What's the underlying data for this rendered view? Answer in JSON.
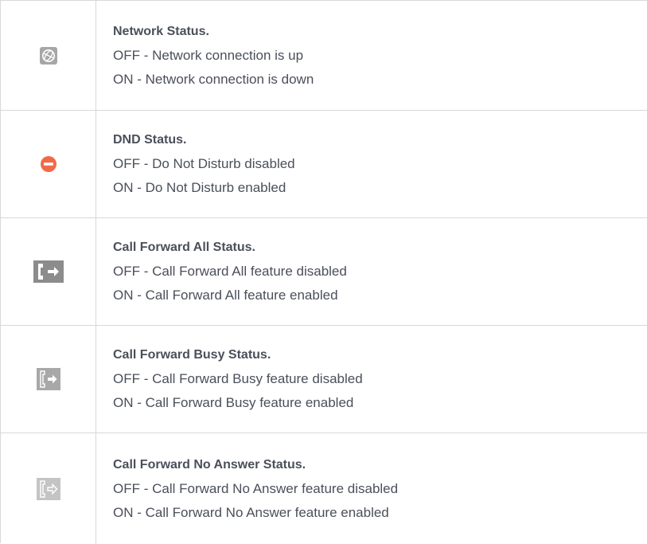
{
  "rows": [
    {
      "icon": "network-globe-icon",
      "title": "Network Status.",
      "off": "OFF - Network connection is up",
      "on": "ON - Network connection is down"
    },
    {
      "icon": "dnd-icon",
      "title": "DND Status.",
      "off": "OFF - Do Not Disturb disabled",
      "on": "ON - Do Not Disturb enabled"
    },
    {
      "icon": "call-forward-all-icon",
      "title": "Call Forward All Status.",
      "off": "OFF - Call Forward All feature disabled",
      "on": "ON - Call Forward All feature enabled"
    },
    {
      "icon": "call-forward-busy-icon",
      "title": "Call Forward Busy Status.",
      "off": "OFF - Call Forward Busy feature disabled",
      "on": "ON - Call Forward Busy feature enabled"
    },
    {
      "icon": "call-forward-no-answer-icon",
      "title": "Call Forward No Answer Status.",
      "off": "OFF - Call Forward No Answer feature disabled",
      "on": "ON - Call Forward No Answer feature enabled"
    }
  ],
  "colors": {
    "text": "#4a4f5a",
    "border": "#d8d8d8",
    "dnd_red": "#f06a4a",
    "icon_gray": "#9a9a9a"
  }
}
